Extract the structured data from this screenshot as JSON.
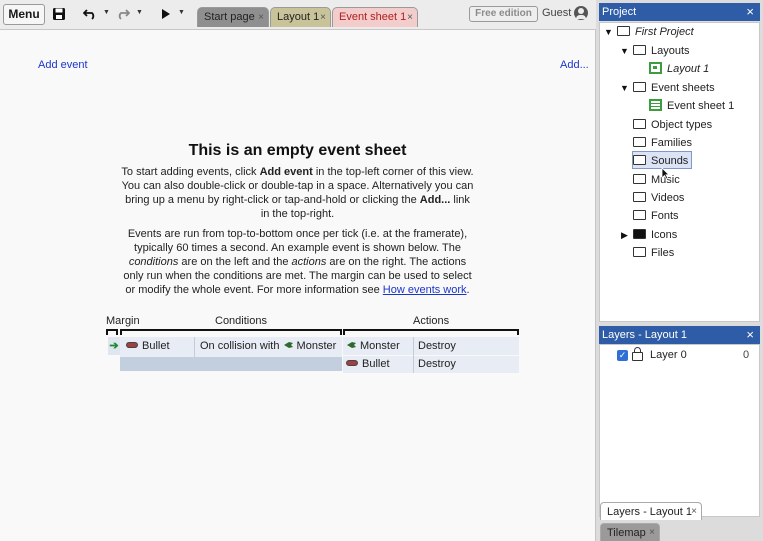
{
  "toolbar": {
    "menu_label": "Menu",
    "tabs": [
      {
        "label": "Start page"
      },
      {
        "label": "Layout 1"
      },
      {
        "label": "Event sheet 1"
      }
    ],
    "close_glyph": "×",
    "free_edition_label": "Free edition",
    "user_label": "Guest",
    "icons": [
      "save-icon",
      "undo-icon",
      "redo-icon",
      "play-icon",
      "user-icon"
    ]
  },
  "sheet": {
    "add_event_link": "Add event",
    "add_menu_link": "Add...",
    "title": "This is an empty event sheet",
    "para1": {
      "t1": "To start adding events, click ",
      "b1": "Add event",
      "t2": " in the top-left corner of this view. You can also double-click or double-tap in a space. Alternatively you can bring up a menu by right-click or tap-and-hold or clicking the ",
      "b2": "Add...",
      "t3": " link in the top-right."
    },
    "para2": {
      "t1": "Events are run from top-to-bottom once per tick (i.e. at the framerate), typically 60 times a second. An example event is shown below. The ",
      "i1": "conditions",
      "t2": " are on the left and the ",
      "i2": "actions",
      "t3": " are on the right. The actions only run when the conditions are met. The margin can be used to select or modify the whole event. For more information see ",
      "link": "How events work",
      "t4": "."
    },
    "example": {
      "headers": {
        "margin": "Margin",
        "conditions": "Conditions",
        "actions": "Actions"
      },
      "condition": {
        "object": "Bullet",
        "text": "On collision with",
        "target": "Monster"
      },
      "actions": [
        {
          "object": "Monster",
          "action": "Destroy"
        },
        {
          "object": "Bullet",
          "action": "Destroy"
        }
      ]
    }
  },
  "project": {
    "title": "Project",
    "close_glyph": "×",
    "tree": [
      {
        "label": "First Project"
      },
      {
        "label": "Layouts"
      },
      {
        "label": "Layout 1"
      },
      {
        "label": "Event sheets"
      },
      {
        "label": "Event sheet 1"
      },
      {
        "label": "Object types"
      },
      {
        "label": "Families"
      },
      {
        "label": "Sounds"
      },
      {
        "label": "Music"
      },
      {
        "label": "Videos"
      },
      {
        "label": "Fonts"
      },
      {
        "label": "Icons"
      },
      {
        "label": "Files"
      }
    ]
  },
  "layers": {
    "title": "Layers - Layout 1",
    "close_glyph": "×",
    "rows": [
      {
        "name": "Layer 0",
        "index": "0",
        "checked": true
      }
    ]
  },
  "bottom_tabs": [
    {
      "label": "Layers - Layout 1"
    },
    {
      "label": "Tilemap"
    }
  ],
  "colors": {
    "panel_header": "#2f5ca6",
    "link": "#1a36c8",
    "active_tab": "#f3cccc"
  }
}
